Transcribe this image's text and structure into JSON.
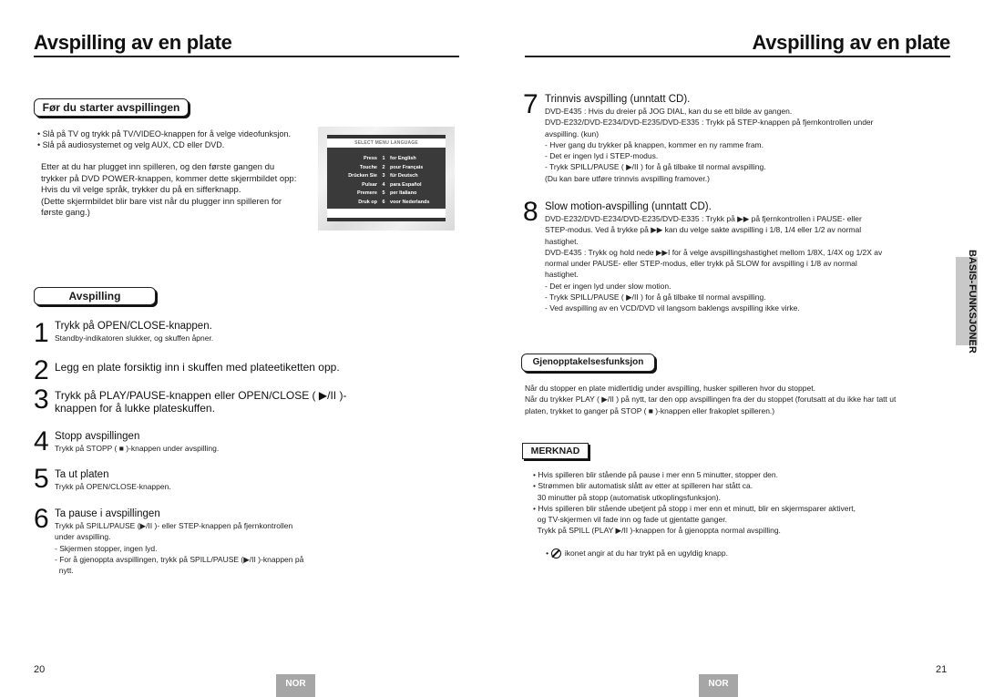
{
  "left_page": {
    "title": "Avspilling av en plate",
    "before_start": {
      "heading": "Før du starter avspillingen",
      "bullets": [
        "• Slå på TV og trykk på TV/VIDEO-knappen for å velge videofunksjon.",
        "• Slå på audiosystemet og velg AUX, CD eller DVD."
      ],
      "paragraph_lines": [
        "Etter at du har plugget inn spilleren, og den første gangen du",
        "trykker på DVD POWER-knappen, kommer dette skjermbildet opp:",
        "Hvis du vil velge språk, trykker du på en sifferknapp.",
        "(Dette skjermbildet blir bare vist når du plugger inn spilleren for",
        "første gang.)"
      ],
      "screen": {
        "header": "SELECT MENU LANGUAGE",
        "rows": [
          {
            "press": "Press",
            "num": "1",
            "lang": "for English"
          },
          {
            "press": "Touche",
            "num": "2",
            "lang": "pour Français"
          },
          {
            "press": "Drücken Sie",
            "num": "3",
            "lang": "für Deutsch"
          },
          {
            "press": "Pulsar",
            "num": "4",
            "lang": "para Español"
          },
          {
            "press": "Premere",
            "num": "5",
            "lang": "per Italiano"
          },
          {
            "press": "Druk op",
            "num": "6",
            "lang": "voor Nederlands"
          }
        ]
      }
    },
    "playback": {
      "heading": "Avspilling",
      "steps": [
        {
          "num": "1",
          "head": "Trykk på OPEN/CLOSE-knappen.",
          "sub": [
            "Standby-indikatoren slukker, og skuffen åpner."
          ]
        },
        {
          "num": "2",
          "head": "Legg en plate forsiktig inn i skuffen med plateetiketten opp.",
          "sub": []
        },
        {
          "num": "3",
          "head_lines": [
            "Trykk på PLAY/PAUSE-knappen eller OPEN/CLOSE ( ▶/II )-",
            "knappen for å lukke plateskuffen."
          ],
          "sub": []
        },
        {
          "num": "4",
          "head": "Stopp avspillingen",
          "sub": [
            "Trykk på STOPP ( ■ )-knappen under avspilling."
          ]
        },
        {
          "num": "5",
          "head": "Ta ut platen",
          "sub": [
            "Trykk på OPEN/CLOSE-knappen."
          ]
        },
        {
          "num": "6",
          "head": "Ta pause i avspillingen",
          "sub": [
            "Trykk på SPILL/PAUSE (▶/II )- eller STEP-knappen på fjernkontrollen",
            "under avspilling.",
            "- Skjermen stopper, ingen lyd.",
            "- For å gjenoppta avspillingen, trykk på SPILL/PAUSE (▶/II )-knappen på",
            "  nytt."
          ]
        }
      ]
    },
    "page_number": "20",
    "lang_badge": "NOR"
  },
  "right_page": {
    "title": "Avspilling av en plate",
    "steps": [
      {
        "num": "7",
        "head": "Trinnvis avspilling (unntatt CD).",
        "sub": [
          "DVD-E435 : Hvis du dreier på JOG DIAL, kan du se ett bilde av gangen.",
          "DVD-E232/DVD-E234/DVD-E235/DVD-E335 : Trykk på STEP-knappen på fjernkontrollen under",
          "avspilling. (kun)",
          "- Hver gang du trykker på knappen, kommer en ny ramme fram.",
          "- Det er ingen lyd i STEP-modus.",
          "- Trykk SPILL/PAUSE ( ▶/II ) for å gå tilbake til normal avspilling.",
          "(Du kan bare utføre trinnvis avspilling framover.)"
        ]
      },
      {
        "num": "8",
        "head": "Slow motion-avspilling (unntatt CD).",
        "sub": [
          "DVD-E232/DVD-E234/DVD-E235/DVD-E335 : Trykk på  ▶▶ på fjernkontrollen i PAUSE- eller",
          "STEP-modus. Ved å trykke på  ▶▶ kan du velge sakte avspilling i 1/8, 1/4 eller 1/2 av normal",
          "hastighet.",
          "DVD-E435 : Trykk og hold nede ▶▶I for å velge avspillingshastighet mellom 1/8X, 1/4X og 1/2X av",
          "normal under PAUSE- eller STEP-modus, eller trykk på SLOW for avspilling i 1/8 av normal",
          "hastighet.",
          "- Det er ingen lyd under slow motion.",
          "- Trykk SPILL/PAUSE ( ▶/II ) for å gå tilbake til normal avspilling.",
          "- Ved avspilling av en VCD/DVD vil langsom baklengs avspilling ikke virke."
        ]
      }
    ],
    "resume": {
      "heading": "Gjenopptakelsesfunksjon",
      "lines": [
        "Når du stopper en plate midlertidig under avspilling, husker spilleren hvor du stoppet.",
        "Når du trykker PLAY ( ▶/II ) på nytt, tar den opp avspillingen fra der du stoppet (forutsatt at du ikke har tatt ut",
        "platen, trykket to ganger på STOP (  ■  )-knappen eller frakoplet spilleren.)"
      ]
    },
    "note": {
      "heading": "MERKNAD",
      "lines": [
        "• Hvis spilleren blir stående på pause i mer enn 5 minutter, stopper den.",
        "• Strømmen blir automatisk slått av etter at spilleren har stått ca.",
        "  30 minutter på stopp (automatisk utkoplingsfunksjon).",
        "• Hvis spilleren blir stående ubetjent på stopp i mer enn et minutt, blir en skjermsparer aktivert,",
        "  og TV-skjermen vil fade inn og fade ut gjentatte ganger.",
        "  Trykk på SPILL (PLAY ▶/II )-knappen for å gjenoppta normal avspilling."
      ],
      "last_line_prefix": "• ",
      "last_line_icon": "prohibited-icon",
      "last_line_text": " ikonet angir at du har trykt på en ugyldig knapp."
    },
    "side_tab": {
      "line1": "BASIS-",
      "line2": "FUNKSJONER"
    },
    "page_number": "21",
    "lang_badge": "NOR"
  }
}
